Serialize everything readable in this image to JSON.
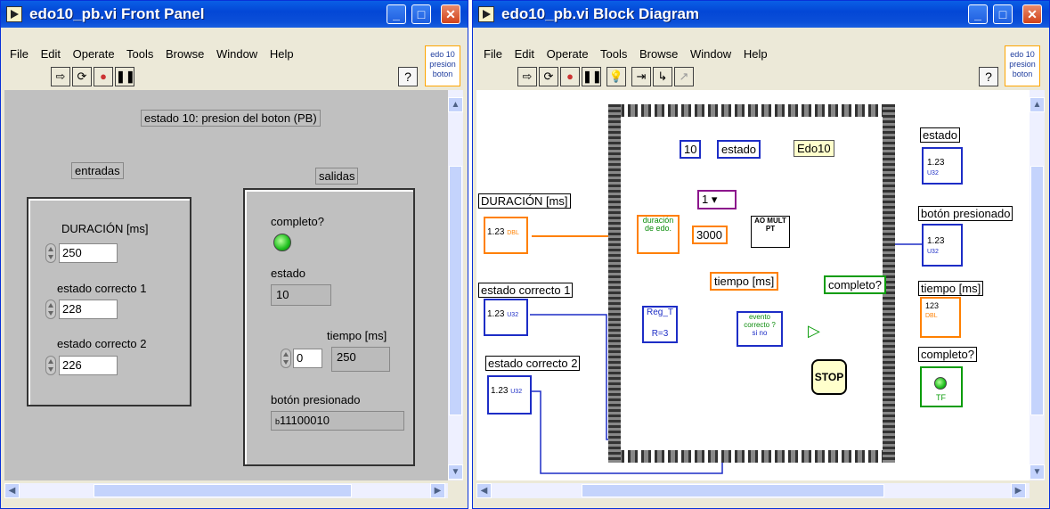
{
  "front": {
    "title": "edo10_pb.vi Front Panel",
    "menu": [
      "File",
      "Edit",
      "Operate",
      "Tools",
      "Browse",
      "Window",
      "Help"
    ],
    "icon_text": "edo 10\npresion\nboton",
    "help_glyph": "?",
    "heading": "estado 10: presion del boton (PB)",
    "inputs_label": "entradas",
    "outputs_label": "salidas",
    "duracion_label": "DURACIÓN [ms]",
    "duracion_value": "250",
    "ec1_label": "estado correcto 1",
    "ec1_value": "228",
    "ec2_label": "estado correcto 2",
    "ec2_value": "226",
    "completo_label": "completo?",
    "completo_on": true,
    "estado_label": "estado",
    "estado_value": "10",
    "tiempo_label": "tiempo [ms]",
    "tiempo_array_index": "0",
    "tiempo_value": "250",
    "boton_label": "botón presionado",
    "boton_value": "11100010",
    "boton_radix": "b"
  },
  "block": {
    "title": "edo10_pb.vi Block Diagram",
    "menu": [
      "File",
      "Edit",
      "Operate",
      "Tools",
      "Browse",
      "Window",
      "Help"
    ],
    "icon_text": "edo 10\npresion\nboton",
    "help_glyph": "?",
    "const_10": "10",
    "estado_local": "estado",
    "edo_label": "Edo10",
    "duracion_ctrl": "DURACIÓN [ms]",
    "ec1_ctrl": "estado correcto 1",
    "ec2_ctrl": "estado correcto 2",
    "num_glyph": "1.23",
    "dbl_tag": "DBL",
    "u32_tag": "U32",
    "tf_tag": "TF",
    "subvi_duracion": "duración de edo.",
    "const_3000": "3000",
    "ao_label": "AO MULT PT",
    "ring_value": "1",
    "tiempo_local": "tiempo [ms]",
    "completo_local": "completo?",
    "reg_label": "Reg_T",
    "reg_r": "R=3",
    "evento_label": "evento correcto ?",
    "si": "si",
    "no": "no",
    "stop": "STOP",
    "estado_ind": "estado",
    "boton_ind": "botón presionado",
    "tiempo_ind": "tiempo [ms]",
    "completo_ind": "completo?",
    "tiempo_ind_index": "123"
  }
}
